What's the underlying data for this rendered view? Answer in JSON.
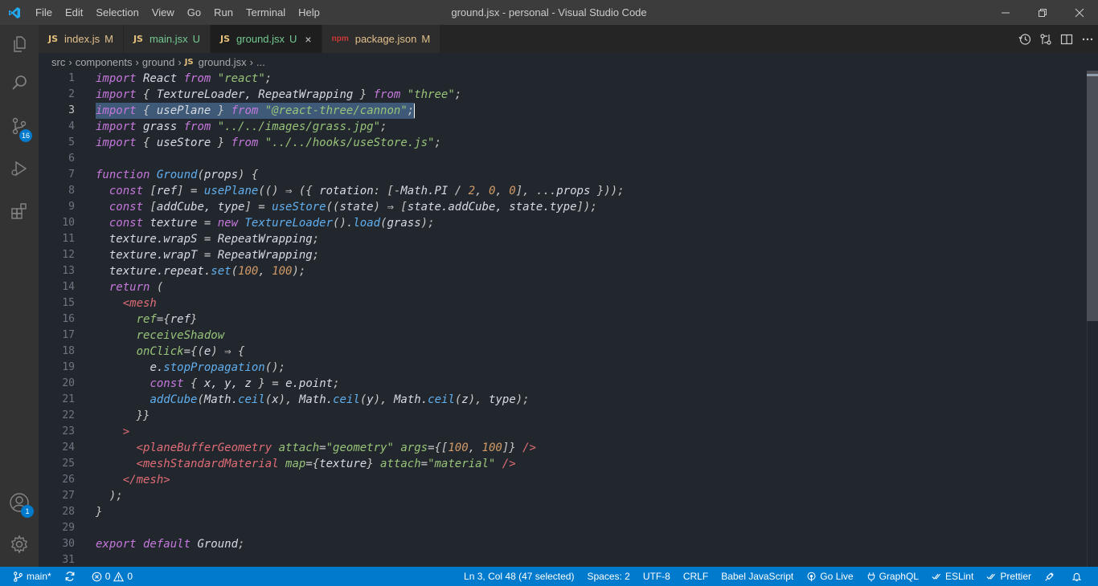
{
  "title_bar": {
    "menu": [
      "File",
      "Edit",
      "Selection",
      "View",
      "Go",
      "Run",
      "Terminal",
      "Help"
    ],
    "title": "ground.jsx - personal - Visual Studio Code"
  },
  "activity_bar": {
    "scm_badge": "16",
    "accounts_badge": "1"
  },
  "tabs": [
    {
      "icon": "JS",
      "name": "index.js",
      "status": "M"
    },
    {
      "icon": "JS",
      "name": "main.jsx",
      "status": "U"
    },
    {
      "icon": "JS",
      "name": "ground.jsx",
      "status": "U",
      "close": "×"
    },
    {
      "icon": "npm",
      "name": "package.json",
      "status": "M"
    }
  ],
  "breadcrumb": {
    "parts": [
      "src",
      "components",
      "ground"
    ],
    "file_icon": "JS",
    "file": "ground.jsx",
    "more": "..."
  },
  "line_numbers": [
    "1",
    "2",
    "3",
    "4",
    "5",
    "6",
    "7",
    "8",
    "9",
    "10",
    "11",
    "12",
    "13",
    "14",
    "15",
    "16",
    "17",
    "18",
    "19",
    "20",
    "21",
    "22",
    "23",
    "24",
    "25",
    "26",
    "27",
    "28",
    "29",
    "30",
    "31"
  ],
  "colors": {
    "keyword": "#c678dd",
    "string": "#98c379",
    "function": "#61afef",
    "variable": "#d7dae0",
    "number": "#d19a66",
    "tag": "#e06c75",
    "attr": "#98c379",
    "punct": "#c8c8c8",
    "status_bar": "#007acc"
  },
  "status_bar": {
    "branch": "main*",
    "errors": "0",
    "warnings": "0",
    "position": "Ln 3, Col 48 (47 selected)",
    "spaces": "Spaces: 2",
    "encoding": "UTF-8",
    "eol": "CRLF",
    "language": "Babel JavaScript",
    "go_live": "Go Live",
    "graphql": "GraphQL",
    "eslint": "ESLint",
    "prettier": "Prettier"
  }
}
